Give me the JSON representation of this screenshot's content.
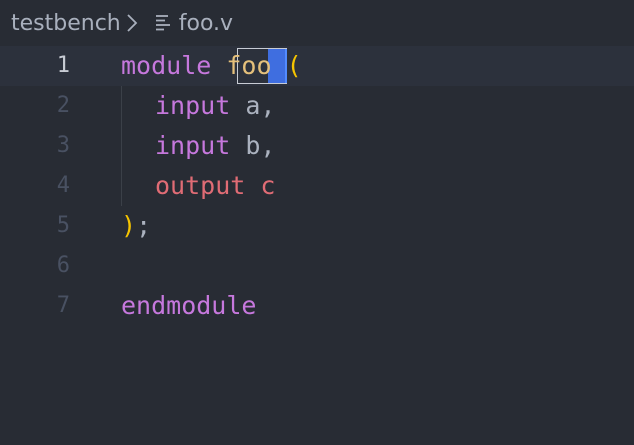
{
  "breadcrumb": {
    "folder": "testbench",
    "file": "foo.v"
  },
  "icons": {
    "separator": "chevron-right-icon",
    "file": "file-lines-icon"
  },
  "editor": {
    "current_line": 1,
    "line_numbers": [
      "1",
      "2",
      "3",
      "4",
      "5",
      "6",
      "7"
    ],
    "lines": [
      {
        "keyword": "module",
        "space": " ",
        "name": "fo",
        "name_selected": "o",
        "paren": "("
      },
      {
        "keyword": "input",
        "rest": " a,"
      },
      {
        "keyword": "input",
        "rest": " b,"
      },
      {
        "keyword": "output",
        "rest": " c"
      },
      {
        "paren": ")",
        "rest": ";"
      },
      {},
      {
        "keyword": "endmodule"
      }
    ]
  }
}
